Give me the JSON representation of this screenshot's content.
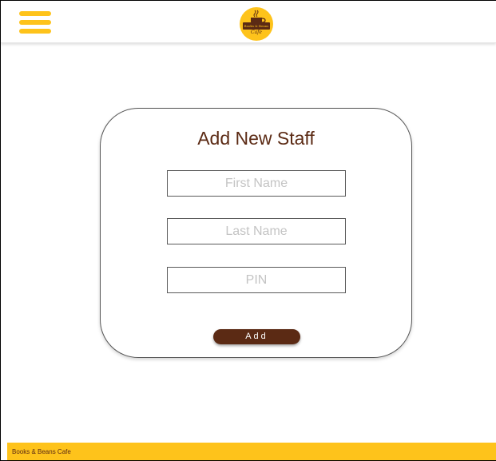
{
  "app": {
    "brand_name": "Books & Beans",
    "brand_sub": "Cafe"
  },
  "form": {
    "title": "Add New Staff",
    "first_name_placeholder": "First Name",
    "first_name_value": "",
    "last_name_placeholder": "Last Name",
    "last_name_value": "",
    "pin_placeholder": "PIN",
    "pin_value": "",
    "add_label": "Add"
  },
  "footer": {
    "text": "Books & Beans Cafe"
  },
  "icons": {
    "menu": "hamburger-menu-icon",
    "logo": "cafe-logo-icon"
  },
  "colors": {
    "accent": "#FEC31B",
    "brand_brown": "#5B2A14",
    "placeholder": "#C4C4C4"
  }
}
